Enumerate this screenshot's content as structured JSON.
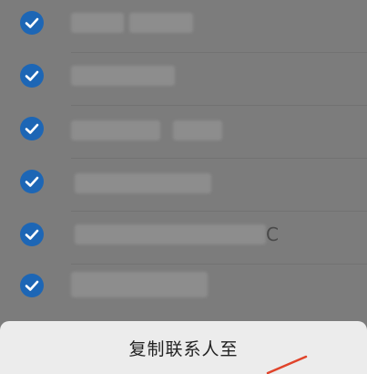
{
  "contacts": [
    {
      "selected": true,
      "visible_text": ""
    },
    {
      "selected": true,
      "visible_text": ""
    },
    {
      "selected": true,
      "visible_text": ""
    },
    {
      "selected": true,
      "visible_text": ""
    },
    {
      "selected": true,
      "visible_text": "C"
    },
    {
      "selected": true,
      "visible_text": ""
    }
  ],
  "sheet": {
    "title": "复制联系人至"
  },
  "colors": {
    "check_accent": "#1d66b5",
    "overlay": "#7c7c7c",
    "sheet_bg": "#ececec",
    "annotation": "#e0442b"
  }
}
